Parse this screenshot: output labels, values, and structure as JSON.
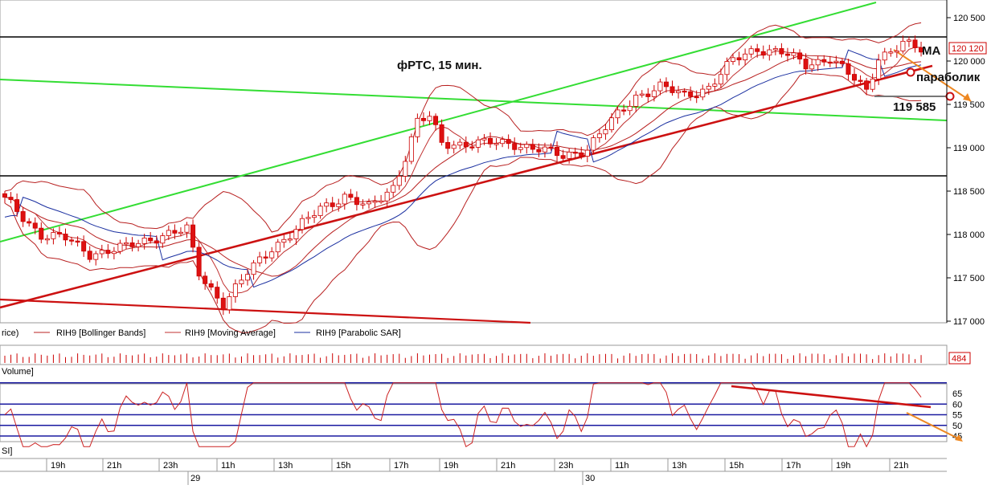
{
  "chart_data": {
    "type": "candlestick",
    "annotation_title": "фРТС,  15 мин.",
    "price_axis": {
      "ticks": [
        "120 500",
        "120 000",
        "119 500",
        "119 000",
        "118 500",
        "118 000",
        "117 500",
        "117 000"
      ],
      "ylim": [
        117000,
        120600
      ]
    },
    "last_price_label": "120 120",
    "volume_label": "484",
    "rsi_ticks": [
      "65",
      "60",
      "55",
      "50",
      "45"
    ],
    "rsi_levels": [
      70,
      60,
      55,
      50,
      45
    ],
    "time_ticks": [
      "19h",
      "21h",
      "23h",
      "11h",
      "13h",
      "15h",
      "17h",
      "19h",
      "21h",
      "23h",
      "11h",
      "13h",
      "15h",
      "17h",
      "19h",
      "21h"
    ],
    "date_ticks": [
      "29",
      "30"
    ],
    "legend": {
      "price": "rice)",
      "bollinger": "RIH9 [Bollinger Bands]",
      "ma": "RIH9 [Moving Average]",
      "psar": "RIH9 [Parabolic SAR]",
      "volume": "Volume]",
      "rsi": "SI]"
    },
    "annotations": {
      "ma": "MA",
      "parabolic": "параболик",
      "level": "119 585"
    },
    "colors": {
      "bull": "#ffffff",
      "bear": "#dd1111",
      "candle_edge": "#cc0000",
      "bollinger": "#b82020",
      "ma": "#c03030",
      "psar": "#1a2fa0",
      "green_line": "#33dd33",
      "red_trend": "#cc1111",
      "rsi_line": "#cc2222",
      "rsi_level": "#1a1aa0",
      "arrow": "#ee8822"
    },
    "levels": {
      "resistance": 120260,
      "support": 118660,
      "marker": 119585
    },
    "series": [
      {
        "name": "price_start",
        "values": [
          118350
        ]
      },
      {
        "name": "ma_end",
        "values": [
          119860
        ]
      },
      {
        "name": "psar_end",
        "values": [
          119700
        ]
      }
    ]
  }
}
